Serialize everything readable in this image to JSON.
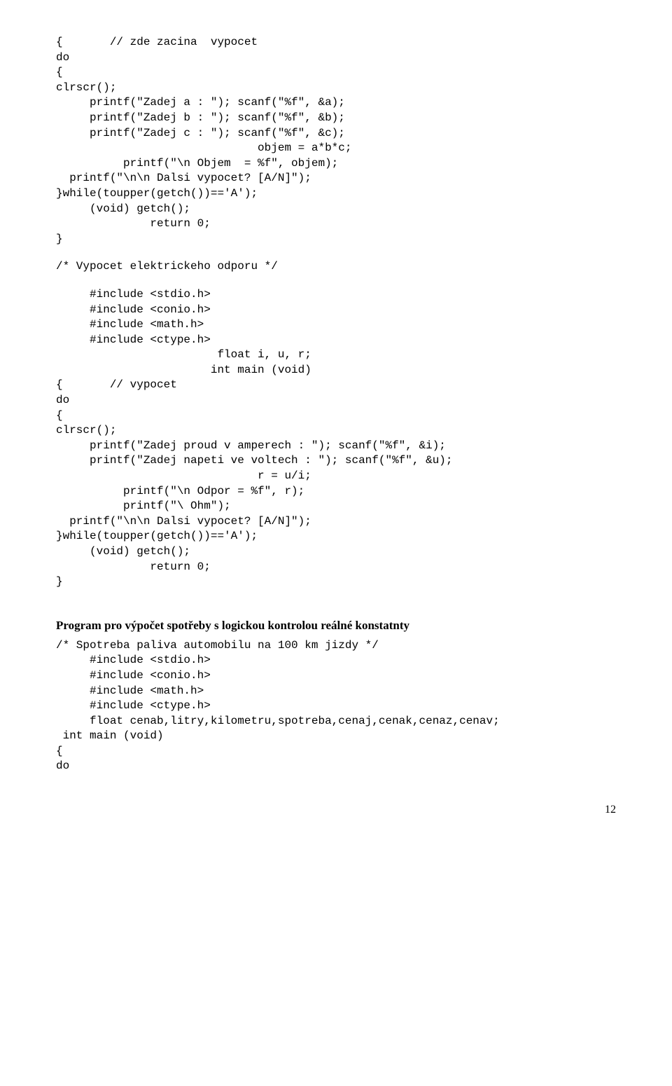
{
  "code_block_1": "{       // zde zacina  vypocet\ndo\n{\nclrscr();\n     printf(\"Zadej a : \"); scanf(\"%f\", &a);\n     printf(\"Zadej b : \"); scanf(\"%f\", &b);\n     printf(\"Zadej c : \"); scanf(\"%f\", &c);\n                              objem = a*b*c;\n          printf(\"\\n Objem  = %f\", objem);\n  printf(\"\\n\\n Dalsi vypocet? [A/N]\");\n}while(toupper(getch())=='A');\n     (void) getch();\n              return 0;\n}",
  "comment_1": "/* Vypocet elektrickeho odporu */",
  "code_block_2": "     #include <stdio.h>\n     #include <conio.h>\n     #include <math.h>\n     #include <ctype.h>\n                        float i, u, r;\n                       int main (void)\n{       // vypocet\ndo\n{\nclrscr();\n     printf(\"Zadej proud v amperech : \"); scanf(\"%f\", &i);\n     printf(\"Zadej napeti ve voltech : \"); scanf(\"%f\", &u);\n                              r = u/i;\n          printf(\"\\n Odpor = %f\", r);\n          printf(\"\\ Ohm\");\n  printf(\"\\n\\n Dalsi vypocet? [A/N]\");\n}while(toupper(getch())=='A');\n     (void) getch();\n              return 0;\n}",
  "heading": "Program pro výpočet spotřeby s logickou kontrolou reálné konstatnty",
  "code_block_3": "/* Spotreba paliva automobilu na 100 km jizdy */\n     #include <stdio.h>\n     #include <conio.h>\n     #include <math.h>\n     #include <ctype.h>\n     float cenab,litry,kilometru,spotreba,cenaj,cenak,cenaz,cenav;\n int main (void)\n{\ndo",
  "page_number": "12"
}
